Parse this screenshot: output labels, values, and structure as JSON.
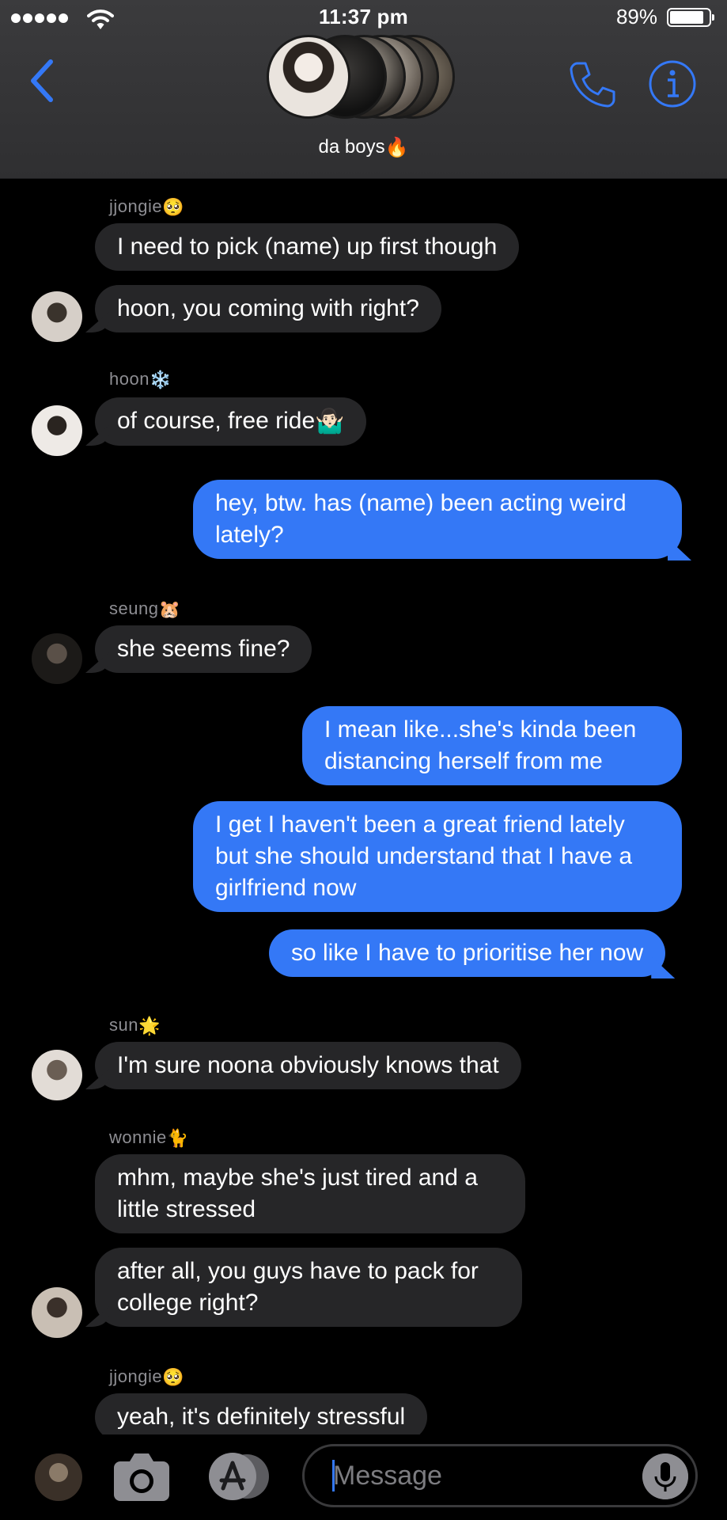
{
  "status_bar": {
    "time": "11:37 pm",
    "battery": "89%"
  },
  "header": {
    "group_name": "da boys"
  },
  "messages": [
    {
      "sender": "jjongie",
      "text": "I need to pick (name) up first though"
    },
    {
      "sender": "jjongie",
      "text": "hoon, you coming with right?"
    },
    {
      "sender": "hoon",
      "text": "of course, free ride"
    },
    {
      "sender": "me",
      "text": "hey, btw. has (name) been acting weird lately?"
    },
    {
      "sender": "seung",
      "text": "she seems fine?"
    },
    {
      "sender": "me",
      "text": "I mean like...she's kinda been distancing herself from me"
    },
    {
      "sender": "me",
      "text": "I get I haven't been a great friend lately but she should understand that I have a girlfriend now"
    },
    {
      "sender": "me",
      "text": "so like I have to prioritise her now"
    },
    {
      "sender": "sun",
      "text": "I'm sure noona obviously knows that"
    },
    {
      "sender": "wonnie",
      "text": "mhm, maybe she's just tired and a little stressed"
    },
    {
      "sender": "wonnie",
      "text": "after all, you guys have to pack for college right?"
    },
    {
      "sender": "jjongie",
      "text": "yeah, it's definitely stressful"
    }
  ],
  "input": {
    "placeholder": "Message"
  },
  "colors": {
    "accent": "#3478f6",
    "incoming": "#262628",
    "header": "#343436"
  }
}
